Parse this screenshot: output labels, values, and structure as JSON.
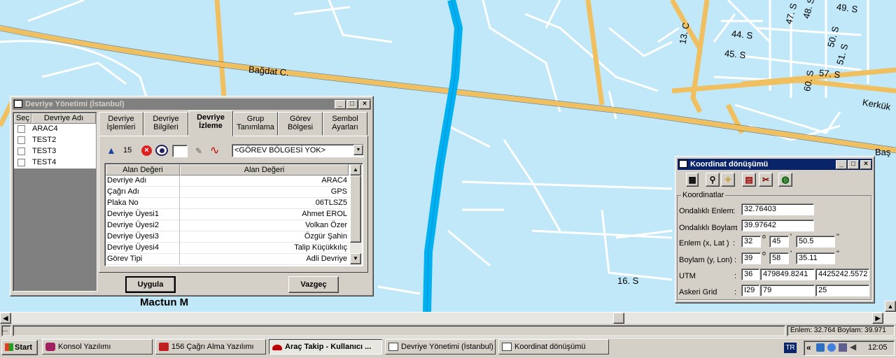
{
  "map": {
    "streets": [
      "Bağdat C.",
      "49. S",
      "44. S",
      "45. S",
      "51. S",
      "50. S",
      "57. S",
      "60. S",
      "13. C",
      "47. S",
      "48. S",
      "Kerkük",
      "Baş",
      "16. S",
      "Mactun M"
    ]
  },
  "devriye_window": {
    "title": "Devriye Yönetimi (İstanbul)",
    "list_headers": [
      "Seç",
      "Devriye Adı"
    ],
    "list_items": [
      "ARAC4",
      "TEST2",
      "TEST3",
      "TEST4"
    ],
    "tabs": [
      {
        "line1": "Devriye",
        "line2": "İşlemleri"
      },
      {
        "line1": "Devriye",
        "line2": "Bilgileri"
      },
      {
        "line1": "Devriye",
        "line2": "İzleme"
      },
      {
        "line1": "Grup",
        "line2": "Tanımlama"
      },
      {
        "line1": "Görev",
        "line2": "Bölgesi"
      },
      {
        "line1": "Sembol",
        "line2": "Ayarları"
      }
    ],
    "active_tab": "Devriye İzleme",
    "toolbar": {
      "interval": "15",
      "region_select": "<GÖREV BÖLGESİ YOK>"
    },
    "grid_headers": [
      "Alan Değeri",
      "Alan Değeri"
    ],
    "grid_rows": [
      {
        "key": "Devriye Adı",
        "value": "ARAC4"
      },
      {
        "key": "Çağrı Adı",
        "value": "GPS"
      },
      {
        "key": "Plaka No",
        "value": "06TLSZ5"
      },
      {
        "key": "Devriye Üyesi1",
        "value": "Ahmet EROL"
      },
      {
        "key": "Devriye Üyesi2",
        "value": "Volkan Özer"
      },
      {
        "key": "Devriye Üyesi3",
        "value": "Özgür Şahin"
      },
      {
        "key": "Devriye Üyesi4",
        "value": "Talip Küçükkılıç"
      },
      {
        "key": "Görev Tipi",
        "value": "Adli Devriye"
      }
    ],
    "apply_label": "Uygula",
    "cancel_label": "Vazgeç"
  },
  "koordinat_window": {
    "title": "Koordinat dönüşümü",
    "group_label": "Koordinatlar",
    "labels": {
      "lat_decimal": "Ondalıklı Enlem",
      "lon_decimal": "Ondalıklı Boylam",
      "lat_dms": "Enlem (x, Lat )",
      "lon_dms": "Boylam (y, Lon)",
      "utm": "UTM",
      "mgrs": "Askeri Grid"
    },
    "values": {
      "lat_decimal": "32.76403",
      "lon_decimal": "39.97642",
      "lat_deg": "32",
      "lat_min": "45",
      "lat_sec": "50.5",
      "lon_deg": "39",
      "lon_min": "58",
      "lon_sec": "35.11",
      "utm_zone": "36",
      "utm_e": "479849.8241",
      "utm_n": "4425242.5572",
      "mgrs_1": "I29",
      "mgrs_2": "79",
      "mgrs_3": "25"
    }
  },
  "statusbar": {
    "left": "...",
    "right": "Enlem: 32.764 Boylam: 39.971"
  },
  "taskbar": {
    "start_label": "Start",
    "items": [
      {
        "label": "Konsol Yazılımı",
        "active": false
      },
      {
        "label": "156 Çağrı Alma Yazılımı",
        "active": false
      },
      {
        "label": "Araç Takip - Kullanıcı ...",
        "active": true
      },
      {
        "label": "Devriye Yönetimi (İstanbul)",
        "active": false
      },
      {
        "label": "Koordinat dönüşümü",
        "active": false
      }
    ],
    "lang": "TR",
    "clock": "12:05"
  },
  "colors": {
    "map_bg": "#c0e8f8",
    "road_main": "#f0c060",
    "road_minor": "#ffffff",
    "river": "#00b0f0",
    "window": "#d4d0c8"
  }
}
